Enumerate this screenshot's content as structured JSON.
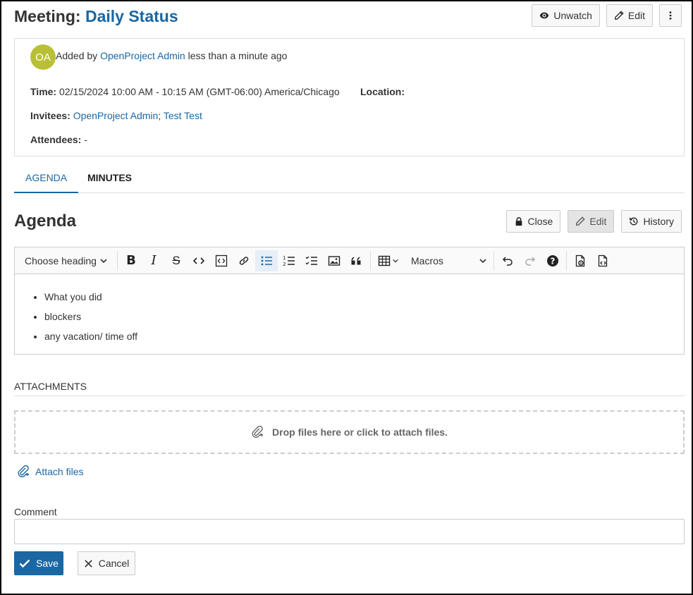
{
  "header": {
    "title_prefix": "Meeting:",
    "title_name": "Daily Status",
    "unwatch_label": "Unwatch",
    "edit_label": "Edit"
  },
  "details": {
    "avatar_initials": "OA",
    "added_by_prefix": "Added by",
    "added_by_user": "OpenProject Admin",
    "added_time": "less than a minute ago",
    "time_label": "Time:",
    "time_value": "02/15/2024 10:00 AM - 10:15 AM (GMT-06:00) America/Chicago",
    "location_label": "Location:",
    "invitees_label": "Invitees:",
    "invitees": [
      "OpenProject Admin",
      "Test Test"
    ],
    "attendees_label": "Attendees:",
    "attendees_value": "-"
  },
  "tabs": [
    {
      "label": "Agenda"
    },
    {
      "label": "Minutes"
    }
  ],
  "agenda": {
    "title": "Agenda",
    "close_label": "Close",
    "edit_label": "Edit",
    "history_label": "History"
  },
  "editor": {
    "heading_select": "Choose heading",
    "macros_select": "Macros",
    "items": [
      "What you did",
      "blockers",
      "any vacation/ time off"
    ]
  },
  "attachments": {
    "title": "Attachments",
    "dropzone_text": "Drop files here or click to attach files.",
    "attach_link": "Attach files"
  },
  "comment": {
    "label": "Comment",
    "value": ""
  },
  "actions": {
    "save_label": "Save",
    "cancel_label": "Cancel"
  },
  "colors": {
    "accent": "#1a67a3",
    "avatar": "#b9c037"
  }
}
